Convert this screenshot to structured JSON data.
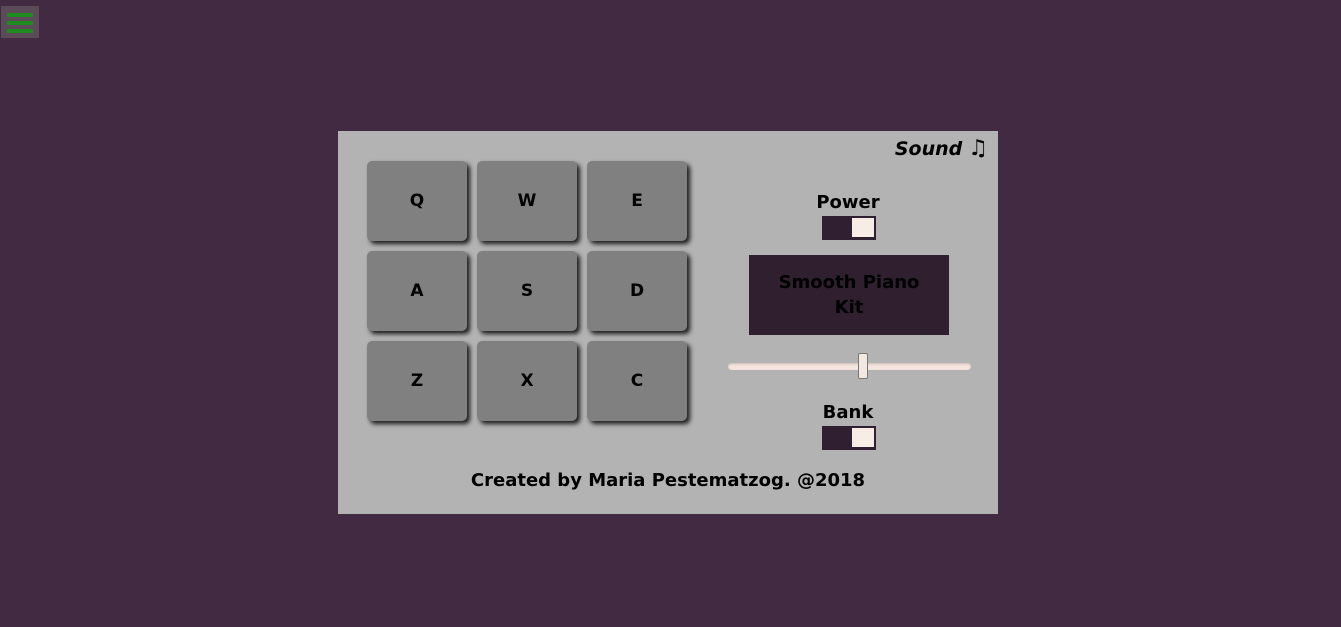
{
  "app": {
    "logo_text": "Sound",
    "logo_icon": "music-note-icon"
  },
  "menu": {
    "icon": "hamburger-icon"
  },
  "pads": [
    {
      "key": "Q"
    },
    {
      "key": "W"
    },
    {
      "key": "E"
    },
    {
      "key": "A"
    },
    {
      "key": "S"
    },
    {
      "key": "D"
    },
    {
      "key": "Z"
    },
    {
      "key": "X"
    },
    {
      "key": "C"
    }
  ],
  "controls": {
    "power_label": "Power",
    "power_on": true,
    "display_text": "Smooth Piano Kit",
    "volume": 0.56,
    "bank_label": "Bank",
    "bank_on": true
  },
  "footer": {
    "text": "Created by Maria Pestematzog. @2018"
  },
  "colors": {
    "background": "#422b42",
    "machine": "#b3b3b3",
    "pad": "#808080",
    "display": "#2f1f2f",
    "toggle": "#301f30",
    "menu_bars": "#1f8a1f"
  }
}
